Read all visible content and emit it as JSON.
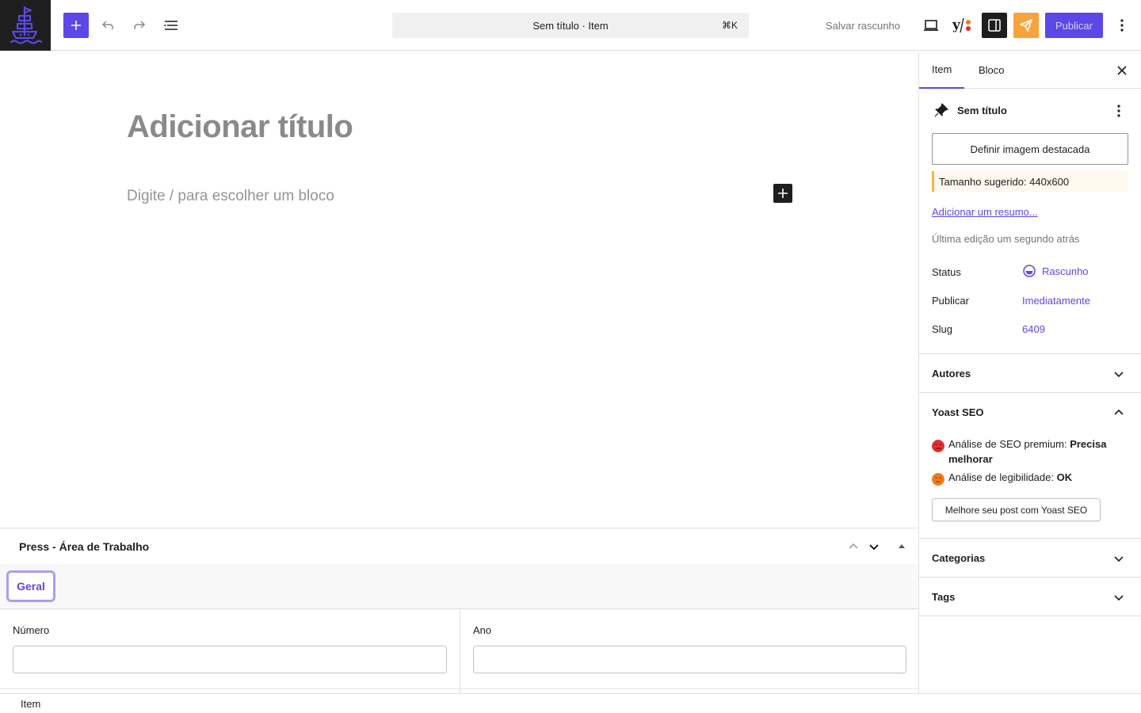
{
  "toolbar": {
    "command_title": "Sem título · Item",
    "command_shortcut": "⌘K",
    "save_draft": "Salvar rascunho",
    "publish": "Publicar",
    "accent": "#5a48e8"
  },
  "editor": {
    "title_placeholder": "Adicionar título",
    "block_placeholder": "Digite / para escolher um bloco"
  },
  "meta_panel": {
    "title": "Press - Área de Trabalho",
    "tabs": [
      "Geral"
    ],
    "fields": [
      {
        "label": "Número",
        "value": ""
      },
      {
        "label": "Ano",
        "value": ""
      }
    ]
  },
  "footer": {
    "breadcrumb": "Item"
  },
  "sidebar": {
    "tabs": [
      "Item",
      "Bloco"
    ],
    "post": {
      "title": "Sem título",
      "featured_image_button": "Definir imagem destacada",
      "size_notice": "Tamanho sugerido: 440x600",
      "excerpt_link": "Adicionar um resumo...",
      "last_edit": "Última edição um segundo atrás",
      "rows": [
        {
          "label": "Status",
          "value": "Rascunho"
        },
        {
          "label": "Publicar",
          "value": "Imediatamente"
        },
        {
          "label": "Slug",
          "value": "6409"
        }
      ]
    },
    "panels": {
      "autores": "Autores",
      "yoast": "Yoast SEO",
      "categorias": "Categorias",
      "tags": "Tags"
    },
    "yoast": {
      "seo_label": "Análise de SEO premium: ",
      "seo_value": "Precisa melhorar",
      "read_label": "Análise de legibilidade: ",
      "read_value": "OK",
      "button": "Melhore seu post com Yoast SEO",
      "seo_color": "#dc3232",
      "read_color": "#ee7c1b"
    }
  }
}
